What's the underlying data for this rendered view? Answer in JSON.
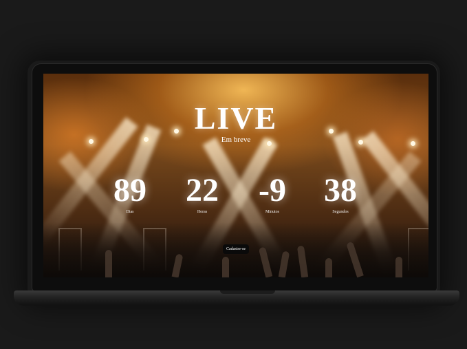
{
  "hero": {
    "title": "LIVE",
    "subtitle": "Em breve"
  },
  "countdown": [
    {
      "value": "89",
      "label": "Dias"
    },
    {
      "value": "22",
      "label": "Horas"
    },
    {
      "value": "-9",
      "label": "Minutos"
    },
    {
      "value": "38",
      "label": "Segundos"
    }
  ],
  "cta": {
    "label": "Cadastre-se"
  }
}
